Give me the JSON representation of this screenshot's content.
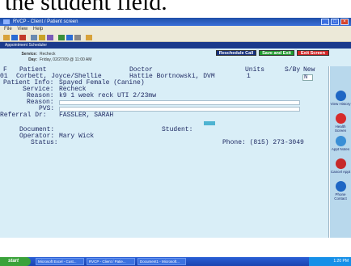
{
  "caption": "the student field.",
  "window": {
    "title": "RVCP - Client / Patient screen",
    "subwindow_title": "Appointment Scheduler"
  },
  "menu": [
    "File",
    "View",
    "Help"
  ],
  "header": {
    "service_label": "Service:",
    "service_value": "Recheck",
    "day_label": "Day:",
    "day_value": "Friday, 02/27/09 @ 11:00 AM",
    "buttons": {
      "reschedule": "Reschedule Call",
      "save_exit": "Save and Exit",
      "exit": "Exit Screen"
    }
  },
  "columns": {
    "patient": "Patient",
    "doctor": "Doctor",
    "units": "Units",
    "sby": "S/By",
    "new": "New"
  },
  "row": {
    "num": "01",
    "patient": "Corbett, Joyce/Shellie",
    "doctor": "Hattie Bortnowski, DVM",
    "units": "1",
    "new": "N"
  },
  "details": {
    "patient_info_label": "Patient Info:",
    "patient_info_value": "Spayed Female (Canine)",
    "service_label": "Service:",
    "service_value": "Recheck",
    "reason_label": "Reason:",
    "reason_value": "k9 1 week reck UTI 2/23mw",
    "reason2_label": "Reason:",
    "pvs_label": "PVS:",
    "referral_label": "Referral Dr:",
    "referral_value": "FASSLER, SARAH",
    "document_label": "Document:",
    "student_label": "Student:",
    "operator_label": "Operator:",
    "operator_value": "Mary Wick",
    "status_label": "Status:",
    "phone": "Phone: (815) 273-3049"
  },
  "sidebar": [
    {
      "label": "View History",
      "icon": "history-icon",
      "color": "#1e66c4"
    },
    {
      "label": "Health Screen",
      "icon": "health-icon",
      "color": "#d62b2b"
    },
    {
      "label": "Appt Notes",
      "icon": "notes-icon",
      "color": "#3a8fd6"
    },
    {
      "label": "Cancel Appt",
      "icon": "cancel-icon",
      "color": "#c62a2a"
    },
    {
      "label": "Phone Contact",
      "icon": "phone-icon",
      "color": "#1e66c4"
    }
  ],
  "taskbar": {
    "start": "start",
    "items": [
      "Microsoft Excel - Cust...",
      "RVCP - Client / Patie...",
      "Document1 - Microsoft..."
    ],
    "clock": "1:20 PM"
  }
}
